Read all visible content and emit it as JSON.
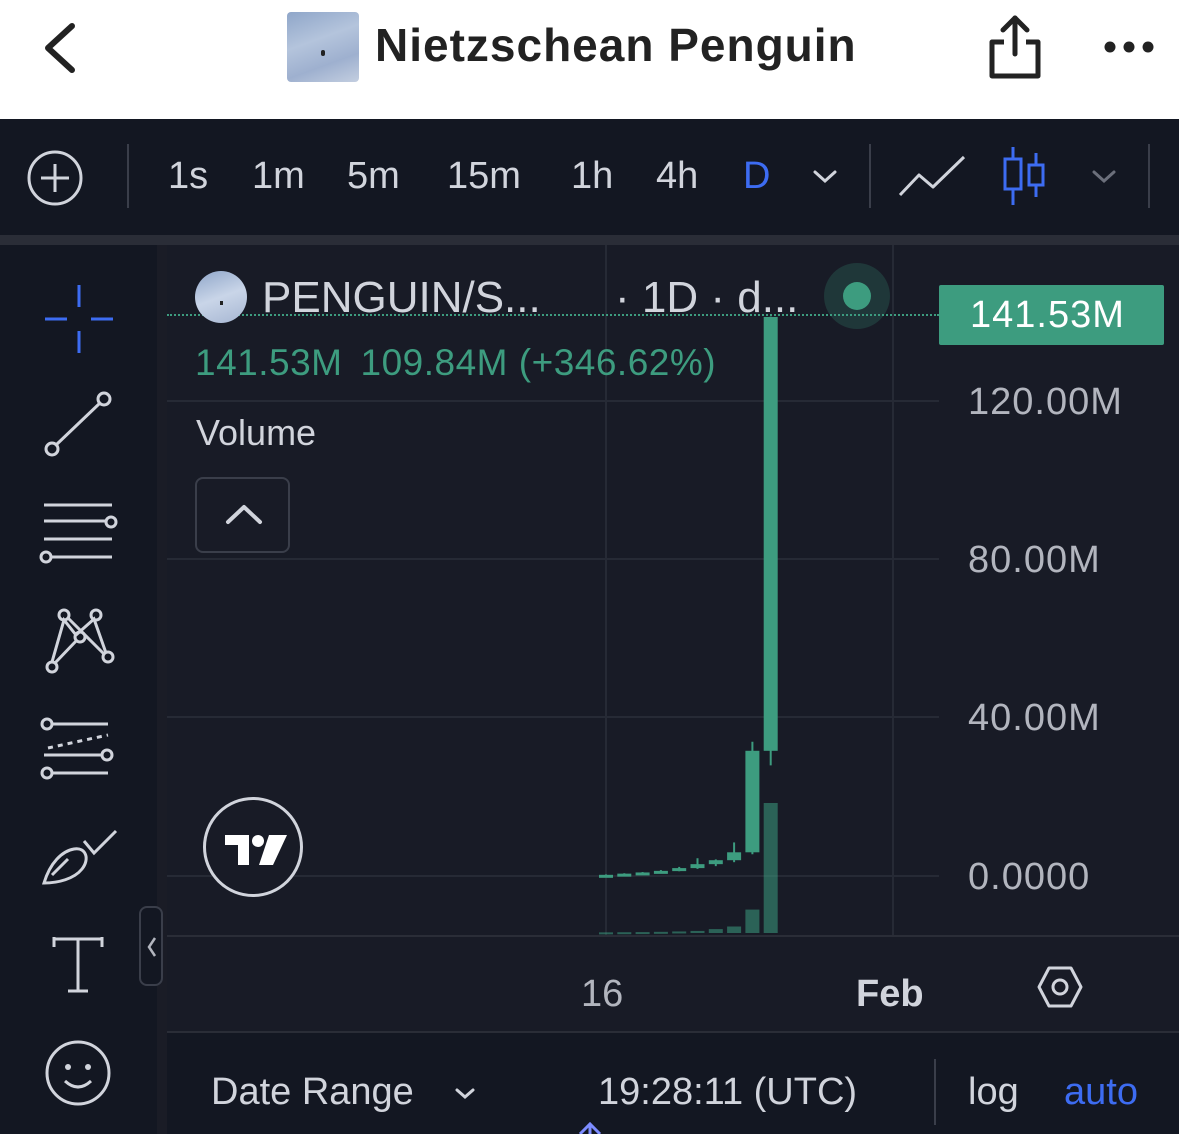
{
  "nav": {
    "title": "Nietzschean Penguin",
    "back_icon": "chevron-left-icon",
    "share_icon": "share-icon",
    "more_icon": "more-dots-icon"
  },
  "toolbar": {
    "add_icon": "plus-circle-icon",
    "timeframes": [
      "1s",
      "1m",
      "5m",
      "15m",
      "1h",
      "4h",
      "D"
    ],
    "active_timeframe": "D",
    "chart_types": [
      "line-chart-icon",
      "candlestick-icon"
    ]
  },
  "tools": [
    "crosshair-icon",
    "trend-line-icon",
    "fib-retracement-icon",
    "pattern-icon",
    "forecast-icon",
    "brush-icon",
    "text-icon",
    "emoji-icon"
  ],
  "chart": {
    "symbol": "PENGUIN/S...",
    "interval": "· 1D · d...",
    "current_price": "141.53M",
    "ohlc_close": "141.53M",
    "ohlc_change": "109.84M (+346.62%)",
    "volume_label": "Volume",
    "accent": "#3d9c7f",
    "price_labels": [
      "120.00M",
      "80.00M",
      "40.00M",
      "0.0000"
    ],
    "x_labels": [
      "16",
      "Feb"
    ]
  },
  "chart_data": {
    "type": "bar",
    "title": "",
    "ylabel": "",
    "ylim": [
      0,
      150000000
    ],
    "candles": [
      {
        "open": 0,
        "close": 0.3,
        "high": 0.4,
        "low": 0
      },
      {
        "open": 0.3,
        "close": 0.6,
        "high": 0.7,
        "low": 0.2
      },
      {
        "open": 0.6,
        "close": 0.9,
        "high": 1.0,
        "low": 0.5
      },
      {
        "open": 0.9,
        "close": 1.3,
        "high": 1.5,
        "low": 0.8
      },
      {
        "open": 1.3,
        "close": 2.0,
        "high": 2.3,
        "low": 1.2
      },
      {
        "open": 2.0,
        "close": 3.0,
        "high": 4.5,
        "low": 1.8
      },
      {
        "open": 3.0,
        "close": 4.0,
        "high": 4.2,
        "low": 2.5
      },
      {
        "open": 4.0,
        "close": 6.0,
        "high": 8.5,
        "low": 3.5
      },
      {
        "open": 6.0,
        "close": 31.7,
        "high": 34.0,
        "low": 5.5
      },
      {
        "open": 31.69,
        "close": 141.53,
        "high": 141.6,
        "low": 28.0
      }
    ],
    "volumes": [
      0.5,
      0.6,
      0.7,
      0.9,
      1.2,
      1.6,
      3.0,
      5.0,
      18.0,
      100.0
    ]
  },
  "bottom": {
    "date_range": "Date Range",
    "time": "19:28:11 (UTC)",
    "log": "log",
    "auto": "auto"
  }
}
